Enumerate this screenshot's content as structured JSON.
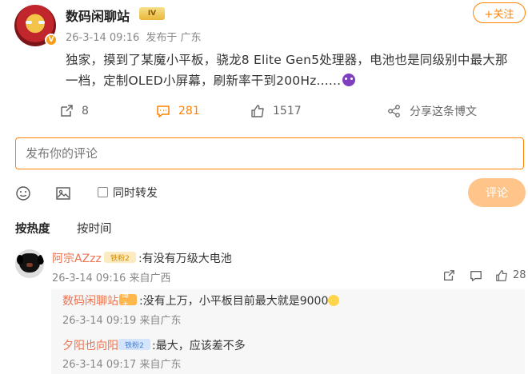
{
  "post": {
    "author": "数码闲聊站",
    "level_badge": "IV",
    "verified_mark": "V",
    "date": "26-3-14 09:16",
    "location": "发布于 广东",
    "follow_label": "+关注",
    "body": "独家，摸到了某魔小平板，骁龙8 Elite Gen5处理器，电池也是同级别中最大那一档，定制OLED小屏幕，刷新率干到200Hz......",
    "trailing_emoji": "devil-emoji"
  },
  "actions": {
    "repost_count": "8",
    "comment_count": "281",
    "like_count": "1517",
    "share_label": "分享这条博文"
  },
  "composer": {
    "placeholder": "发布你的评论",
    "sync_label": "同时转发",
    "submit_label": "评论"
  },
  "sort": {
    "hot_label": "按热度",
    "time_label": "按时间"
  },
  "comments": [
    {
      "user": "阿宗AZzz",
      "badge": "铁粉2",
      "text": ":有没有万级大电池",
      "date": "26-3-14 09:16",
      "location": "来自广西",
      "like_count": "28"
    }
  ],
  "replies": [
    {
      "user": "数码闲聊站",
      "badge": "博主",
      "text": ":没有上万，小平板目前最大就是9000",
      "date": "26-3-14 09:19",
      "location": "来自广东"
    },
    {
      "user": "夕阳也向阳",
      "badge": "铁粉2",
      "text": ":最大，应该差不多",
      "date": "26-3-14 09:17",
      "location": "来自广东"
    }
  ],
  "colors": {
    "accent": "#ff8200",
    "username": "#eb7350",
    "submit_disabled": "#ffc48a"
  }
}
